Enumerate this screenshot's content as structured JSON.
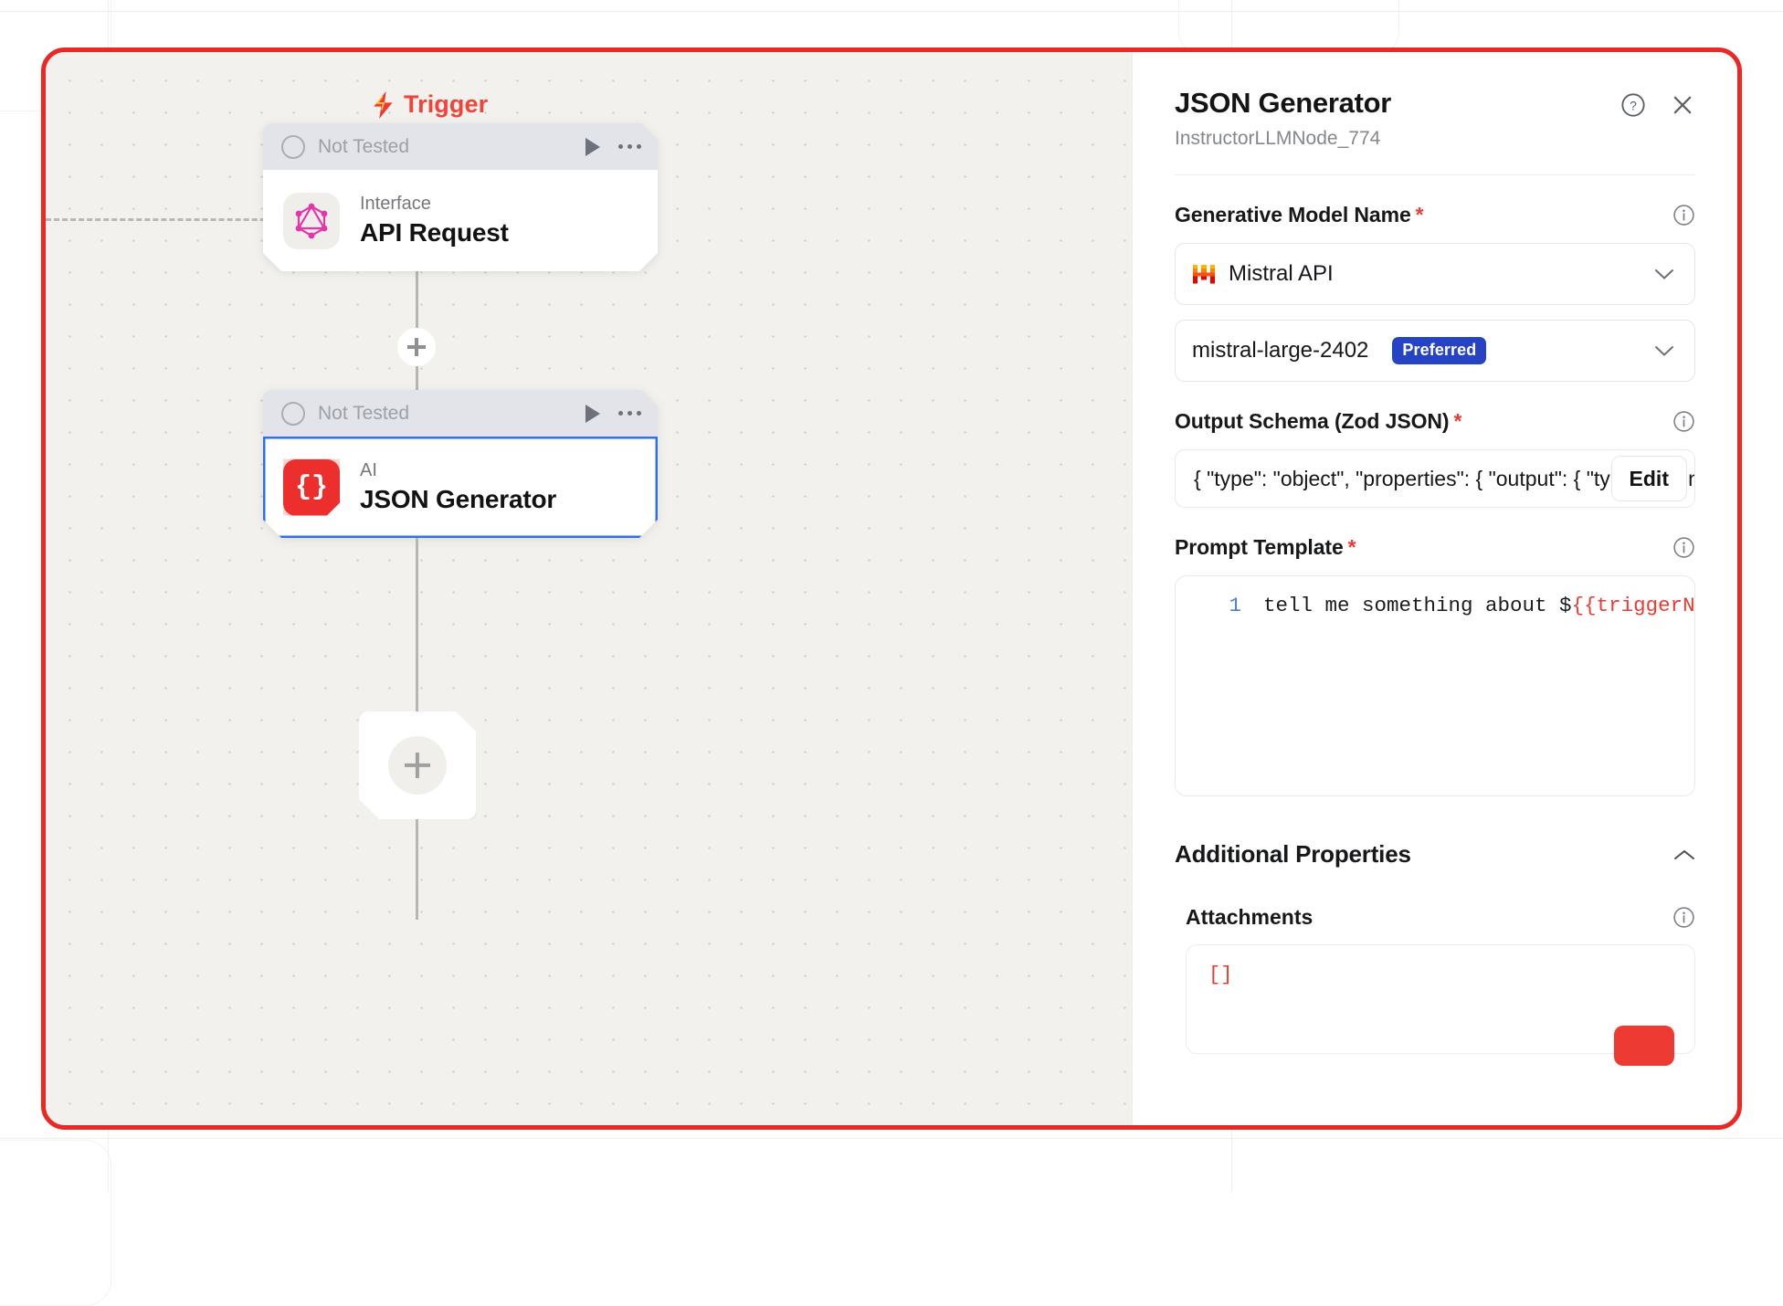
{
  "window": {
    "frame_accent_color": "#ed2724"
  },
  "canvas": {
    "trigger_label": "Trigger",
    "nodes": [
      {
        "status": "Not Tested",
        "kicker": "Interface",
        "title": "API Request",
        "icon": "graphql-icon",
        "selected": false
      },
      {
        "status": "Not Tested",
        "kicker": "AI",
        "title": "JSON Generator",
        "icon": "json-braces-icon",
        "selected": true
      }
    ],
    "add_node_icon": "plus-icon",
    "edge_add_icon": "plus-icon"
  },
  "panel": {
    "title": "JSON Generator",
    "subtitle": "InstructorLLMNode_774",
    "help_icon": "help-circle-icon",
    "close_icon": "close-icon",
    "fields": {
      "model_name": {
        "label": "Generative Model Name",
        "required": "*",
        "info_icon": "info-icon",
        "provider_value": "Mistral API",
        "provider_icon": "mistral-logo-icon",
        "model_value": "mistral-large-2402",
        "model_badge": "Preferred",
        "badge_color": "#2643c4",
        "chevron_icon": "chevron-down-icon"
      },
      "output_schema": {
        "label": "Output Schema (Zod JSON)",
        "required": "*",
        "info_icon": "info-icon",
        "value": "{  \"type\": \"object\", \"properties\": {   \"output\": { \"type\": \"string\" } } }",
        "edit_button": "Edit"
      },
      "prompt_template": {
        "label": "Prompt Template",
        "required": "*",
        "info_icon": "info-icon",
        "line_number": "1",
        "code_text": "tell me something about $",
        "code_variable": "{{triggerNode"
      }
    },
    "additional_properties": {
      "title": "Additional Properties",
      "collapse_icon": "chevron-up-icon",
      "attachments": {
        "label": "Attachments",
        "info_icon": "info-icon",
        "value": "[]"
      }
    }
  }
}
